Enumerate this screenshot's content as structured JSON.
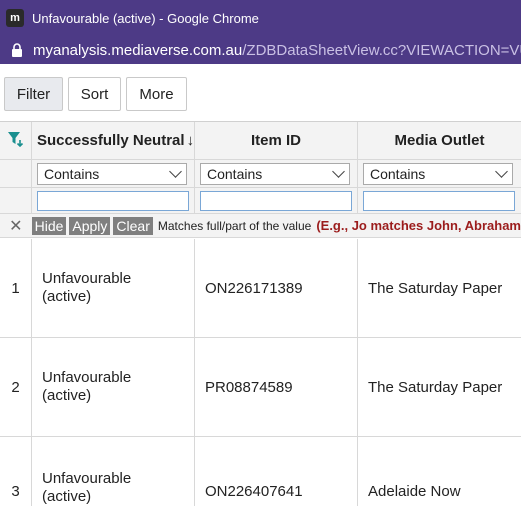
{
  "window": {
    "title": "Unfavourable (active) - Google Chrome",
    "app_icon": "m"
  },
  "address": {
    "host": "myanalysis.mediaverse.com.au",
    "path": "/ZDBDataSheetView.cc?VIEWACTION=VUD"
  },
  "toolbar": {
    "filter_label": "Filter",
    "sort_label": "Sort",
    "more_label": "More"
  },
  "columns": [
    {
      "label": "Successfully Neutral",
      "sort": "descending"
    },
    {
      "label": "Item ID"
    },
    {
      "label": "Media Outlet"
    }
  ],
  "filters": {
    "operator": "Contains"
  },
  "filter_actions": {
    "hide": "Hide",
    "apply": "Apply",
    "clear": "Clear",
    "hint": "Matches full/part of the value",
    "example": "(E.g., Jo matches John, Abraham"
  },
  "rows": [
    {
      "num": "1",
      "line1": "Unfavourable",
      "line2": "(active)",
      "item_id": "ON226171389",
      "outlet": "The Saturday Paper"
    },
    {
      "num": "2",
      "line1": "Unfavourable",
      "line2": "(active)",
      "item_id": "PR08874589",
      "outlet": "The Saturday Paper"
    },
    {
      "num": "3",
      "line1": "Unfavourable",
      "line2": "(active)",
      "item_id": "ON226407641",
      "outlet": "Adelaide Now"
    }
  ],
  "colors": {
    "title_bar": "#4d3a86",
    "filter_icon": "#1a8f8f",
    "example_text": "#9b1c1c"
  },
  "icons": [
    "lock-icon",
    "filter-icon",
    "sort-desc-icon",
    "chevron-down-icon",
    "close-icon"
  ]
}
